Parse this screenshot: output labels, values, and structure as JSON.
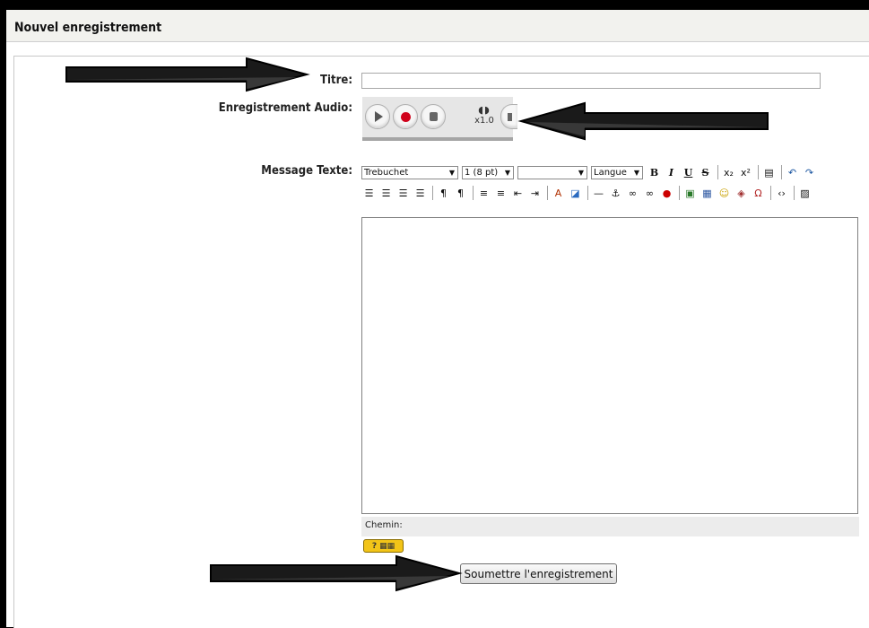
{
  "header": {
    "title": "Nouvel enregistrement"
  },
  "form": {
    "title_label": "Titre:",
    "title_value": "",
    "audio_label": "Enregistrement Audio:",
    "speed_label": "x1.0",
    "message_label": "Message Texte:",
    "path_label": "Chemin:",
    "submit_label": "Soumettre l'enregistrement"
  },
  "toolbar": {
    "font_value": "Trebuchet",
    "size_value": "1 (8 pt)",
    "style_value": "",
    "language_value": "Langue"
  },
  "colors": {
    "record_red": "#d0021b",
    "keyboard_yellow": "#f2c418",
    "header_bg": "#f2f2ee"
  }
}
